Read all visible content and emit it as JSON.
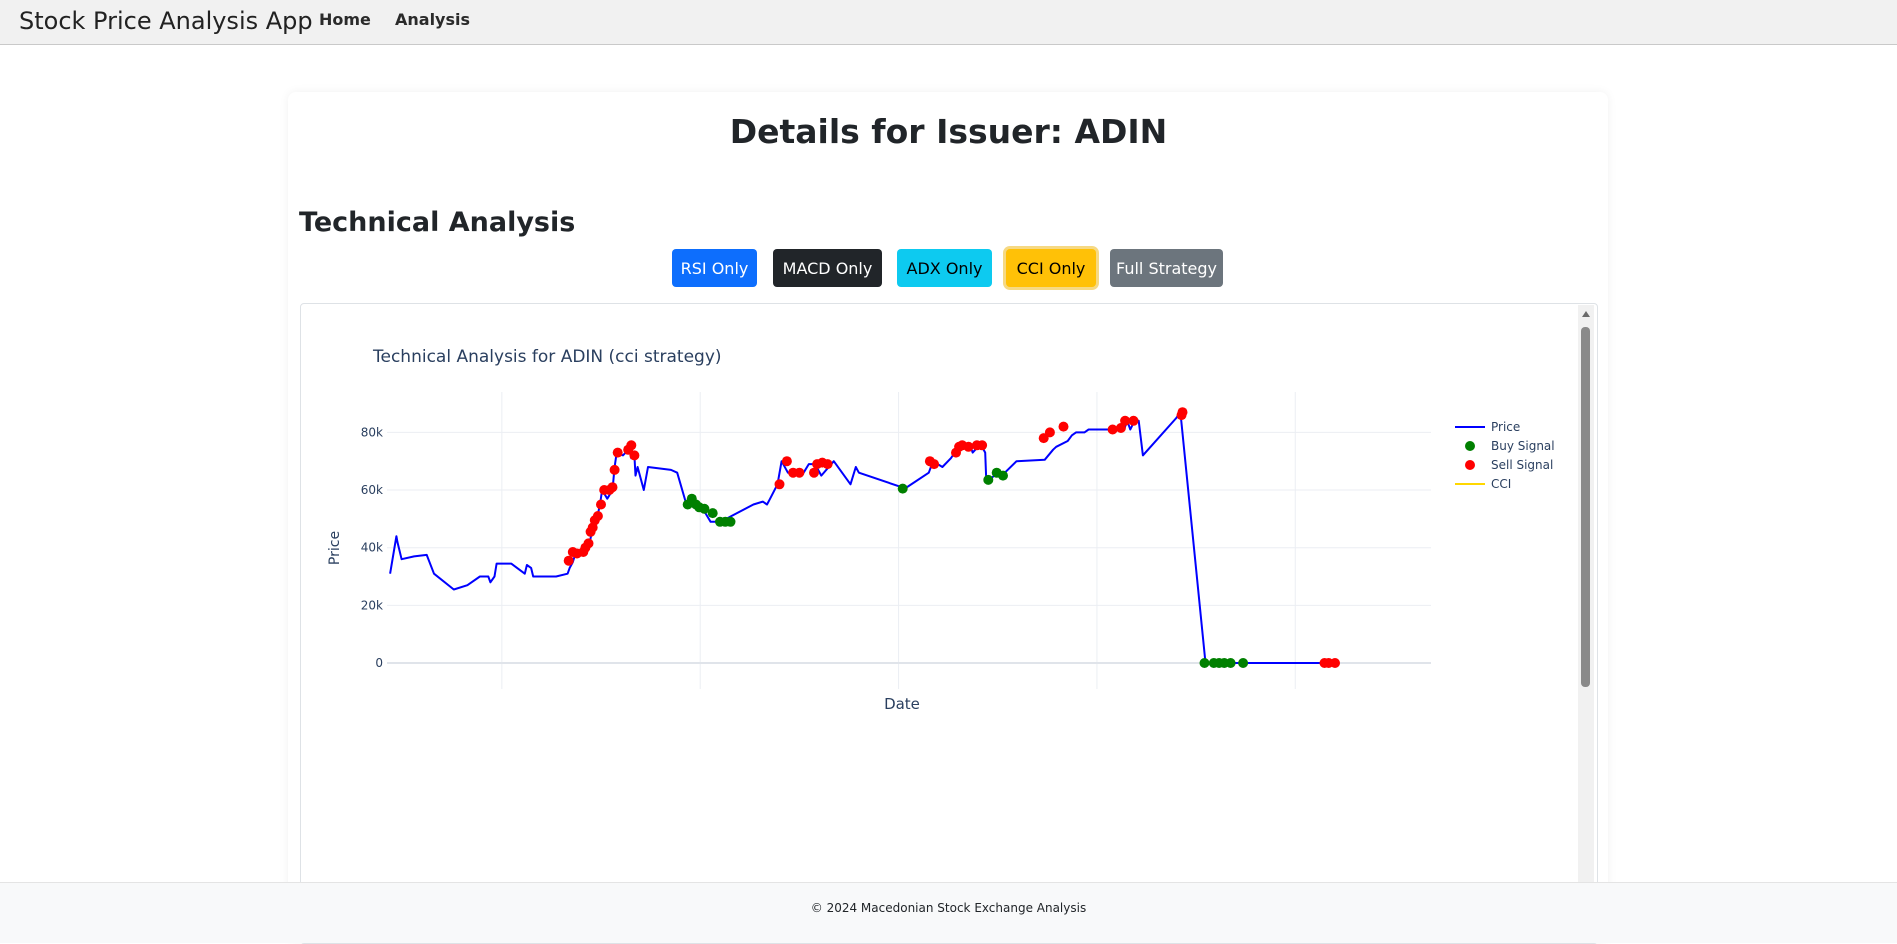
{
  "app": {
    "brand": "Stock Price Analysis App"
  },
  "nav": {
    "home": "Home",
    "analysis": "Analysis"
  },
  "page": {
    "title": "Details for Issuer: ADIN",
    "section_title": "Technical Analysis"
  },
  "strategy_buttons": {
    "rsi": "RSI Only",
    "macd": "MACD Only",
    "adx": "ADX Only",
    "cci": "CCI Only",
    "full": "Full Strategy",
    "active": "cci"
  },
  "footer": {
    "text": "© 2024 Macedonian Stock Exchange Analysis"
  },
  "colors": {
    "price": "#0000ff",
    "buy": "#008000",
    "sell": "#ff0000",
    "cci": "#ffd700",
    "active_button": "#ffc107"
  },
  "chart_data": {
    "type": "line",
    "title": "Technical Analysis for ADIN (cci strategy)",
    "xlabel": "Date",
    "ylabel": "Price",
    "ylim": [
      -9000,
      94000
    ],
    "xlim": [
      0,
      100
    ],
    "y_ticks": [
      0,
      20000,
      40000,
      60000,
      80000
    ],
    "y_tick_labels": [
      "0",
      "20k",
      "40k",
      "60k",
      "80k"
    ],
    "x_ticks": [
      11,
      30,
      49,
      68,
      87
    ],
    "x_tick_labels": [],
    "grid": true,
    "legend_position": "top-right",
    "legend": [
      {
        "name": "Price",
        "kind": "line",
        "color": "#0000ff"
      },
      {
        "name": "Buy Signal",
        "kind": "marker",
        "color": "#008000"
      },
      {
        "name": "Sell Signal",
        "kind": "marker",
        "color": "#ff0000"
      },
      {
        "name": "CCI",
        "kind": "line",
        "color": "#ffd700"
      }
    ],
    "series": [
      {
        "name": "Price",
        "color": "#0000ff",
        "points": [
          [
            0.3,
            31000
          ],
          [
            0.9,
            44000
          ],
          [
            1.0,
            42000
          ],
          [
            1.4,
            36000
          ],
          [
            2.6,
            37000
          ],
          [
            3.8,
            37500
          ],
          [
            4.5,
            31000
          ],
          [
            6.4,
            25500
          ],
          [
            7.7,
            27000
          ],
          [
            8.9,
            30000
          ],
          [
            9.7,
            30000
          ],
          [
            9.9,
            28000
          ],
          [
            10.3,
            30000
          ],
          [
            10.5,
            34500
          ],
          [
            11.9,
            34500
          ],
          [
            13.2,
            31000
          ],
          [
            13.4,
            34000
          ],
          [
            13.8,
            33000
          ],
          [
            14.0,
            30000
          ],
          [
            16.2,
            30000
          ],
          [
            17.3,
            31000
          ],
          [
            17.5,
            33000
          ],
          [
            17.8,
            35000
          ],
          [
            18.1,
            38500
          ],
          [
            18.7,
            39500
          ],
          [
            19.1,
            39000
          ],
          [
            19.4,
            41500
          ],
          [
            19.6,
            45000
          ],
          [
            19.8,
            47500
          ],
          [
            20.1,
            50000
          ],
          [
            20.4,
            55000
          ],
          [
            20.6,
            60000
          ],
          [
            21.1,
            57000
          ],
          [
            21.6,
            60000
          ],
          [
            21.8,
            68000
          ],
          [
            22.0,
            73000
          ],
          [
            22.6,
            72000
          ],
          [
            23.0,
            73500
          ],
          [
            23.3,
            75000
          ],
          [
            23.4,
            71000
          ],
          [
            23.7,
            72000
          ],
          [
            23.8,
            65000
          ],
          [
            24.0,
            68000
          ],
          [
            24.3,
            64000
          ],
          [
            24.6,
            60000
          ],
          [
            25.0,
            68000
          ],
          [
            27.2,
            67000
          ],
          [
            27.8,
            66000
          ],
          [
            28.6,
            56000
          ],
          [
            28.8,
            54000
          ],
          [
            29.4,
            57000
          ],
          [
            29.7,
            56000
          ],
          [
            29.9,
            53000
          ],
          [
            30.5,
            52000
          ],
          [
            31.0,
            49000
          ],
          [
            31.5,
            49000
          ],
          [
            32.0,
            49000
          ],
          [
            33.0,
            51000
          ],
          [
            35.1,
            55000
          ],
          [
            36.0,
            56000
          ],
          [
            36.4,
            55000
          ],
          [
            36.7,
            57000
          ],
          [
            37.4,
            62000
          ],
          [
            37.8,
            70000
          ],
          [
            38.4,
            66000
          ],
          [
            39.0,
            66000
          ],
          [
            39.9,
            66000
          ],
          [
            40.4,
            69000
          ],
          [
            41.0,
            69000
          ],
          [
            41.6,
            65000
          ],
          [
            42.8,
            70000
          ],
          [
            44.4,
            62000
          ],
          [
            44.9,
            68000
          ],
          [
            45.2,
            66000
          ],
          [
            49.3,
            61000
          ],
          [
            49.4,
            60000
          ],
          [
            51.9,
            66000
          ],
          [
            52.3,
            70000
          ],
          [
            53.2,
            68000
          ],
          [
            54.0,
            71000
          ],
          [
            54.4,
            73000
          ],
          [
            54.9,
            75000
          ],
          [
            55.4,
            75000
          ],
          [
            55.9,
            75000
          ],
          [
            56.1,
            73000
          ],
          [
            56.6,
            75000
          ],
          [
            57.0,
            75000
          ],
          [
            57.3,
            73000
          ],
          [
            57.4,
            63000
          ],
          [
            58.2,
            65000
          ],
          [
            58.9,
            65000
          ],
          [
            60.3,
            70000
          ],
          [
            63.0,
            70500
          ],
          [
            63.8,
            74000
          ],
          [
            64.1,
            75000
          ],
          [
            65.2,
            77000
          ],
          [
            65.6,
            79000
          ],
          [
            66.0,
            80000
          ],
          [
            66.8,
            80000
          ],
          [
            67.2,
            81000
          ],
          [
            69.3,
            81000
          ],
          [
            70.6,
            81000
          ],
          [
            70.9,
            84000
          ],
          [
            71.2,
            81000
          ],
          [
            71.6,
            84000
          ],
          [
            72.0,
            84000
          ],
          [
            72.4,
            72000
          ],
          [
            75.6,
            85000
          ],
          [
            76.0,
            87000
          ],
          [
            78.4,
            0
          ],
          [
            79.4,
            0
          ],
          [
            80.6,
            0
          ],
          [
            81.7,
            0
          ],
          [
            82.0,
            0
          ],
          [
            89.8,
            0
          ],
          [
            90.2,
            0
          ],
          [
            91.2,
            0
          ]
        ]
      },
      {
        "name": "Buy Signal",
        "color": "#008000",
        "points": [
          [
            28.8,
            55000
          ],
          [
            29.2,
            57000
          ],
          [
            29.6,
            55000
          ],
          [
            29.9,
            54000
          ],
          [
            30.4,
            53500
          ],
          [
            31.2,
            52000
          ],
          [
            31.9,
            49000
          ],
          [
            32.4,
            49000
          ],
          [
            32.9,
            49000
          ],
          [
            49.4,
            60500
          ],
          [
            57.6,
            63500
          ],
          [
            58.4,
            66000
          ],
          [
            59.0,
            65000
          ],
          [
            78.3,
            0
          ],
          [
            79.2,
            0
          ],
          [
            79.7,
            0
          ],
          [
            80.2,
            0
          ],
          [
            80.8,
            0
          ],
          [
            82.0,
            0
          ]
        ]
      },
      {
        "name": "Sell Signal",
        "color": "#ff0000",
        "points": [
          [
            17.4,
            35500
          ],
          [
            17.8,
            38500
          ],
          [
            18.2,
            38000
          ],
          [
            18.8,
            38500
          ],
          [
            19.0,
            40000
          ],
          [
            19.3,
            41500
          ],
          [
            19.5,
            45500
          ],
          [
            19.7,
            47000
          ],
          [
            19.9,
            49500
          ],
          [
            20.2,
            51000
          ],
          [
            20.5,
            55000
          ],
          [
            20.8,
            60000
          ],
          [
            21.3,
            60000
          ],
          [
            21.6,
            61000
          ],
          [
            21.8,
            67000
          ],
          [
            22.1,
            73000
          ],
          [
            23.1,
            74000
          ],
          [
            23.4,
            75500
          ],
          [
            23.7,
            72000
          ],
          [
            37.6,
            62000
          ],
          [
            38.3,
            70000
          ],
          [
            38.9,
            66000
          ],
          [
            39.5,
            66000
          ],
          [
            40.9,
            66000
          ],
          [
            41.2,
            69000
          ],
          [
            41.7,
            69500
          ],
          [
            42.2,
            69000
          ],
          [
            52.0,
            70000
          ],
          [
            52.4,
            69000
          ],
          [
            54.5,
            73000
          ],
          [
            54.8,
            75000
          ],
          [
            55.1,
            75500
          ],
          [
            55.7,
            75000
          ],
          [
            56.5,
            75500
          ],
          [
            57.0,
            75500
          ],
          [
            62.9,
            78000
          ],
          [
            63.5,
            80000
          ],
          [
            64.8,
            82000
          ],
          [
            69.5,
            81000
          ],
          [
            70.3,
            81500
          ],
          [
            70.7,
            84000
          ],
          [
            71.5,
            84000
          ],
          [
            76.1,
            86000
          ],
          [
            76.2,
            87000
          ],
          [
            89.8,
            0
          ],
          [
            90.2,
            0
          ],
          [
            90.8,
            0
          ]
        ]
      },
      {
        "name": "CCI",
        "color": "#ffd700",
        "points": []
      }
    ]
  }
}
